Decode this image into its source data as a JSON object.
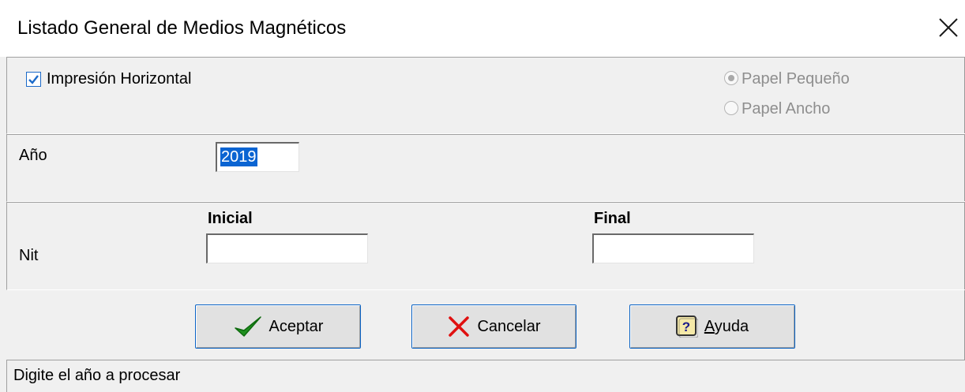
{
  "window": {
    "title": "Listado General de Medios Magnéticos",
    "close_icon": "close-icon"
  },
  "options": {
    "horizontal_label": "Impresión Horizontal",
    "horizontal_checked": true,
    "paper_small_label": "Papel Pequeño",
    "paper_small_selected": true,
    "paper_wide_label": "Papel Ancho",
    "paper_options_enabled": false
  },
  "year": {
    "label": "Año",
    "value": "2019"
  },
  "nit": {
    "label": "Nit",
    "initial_label": "Inicial",
    "initial_value": "",
    "final_label": "Final",
    "final_value": ""
  },
  "buttons": {
    "accept_label": "Aceptar",
    "cancel_label": "Cancelar",
    "help_label_mnemonic": "A",
    "help_label_rest": "yuda"
  },
  "status": {
    "message": "Digite el año a procesar"
  },
  "colors": {
    "accent": "#0a64d2",
    "accept_check": "#1f8f1f",
    "cancel_x": "#e01010"
  }
}
